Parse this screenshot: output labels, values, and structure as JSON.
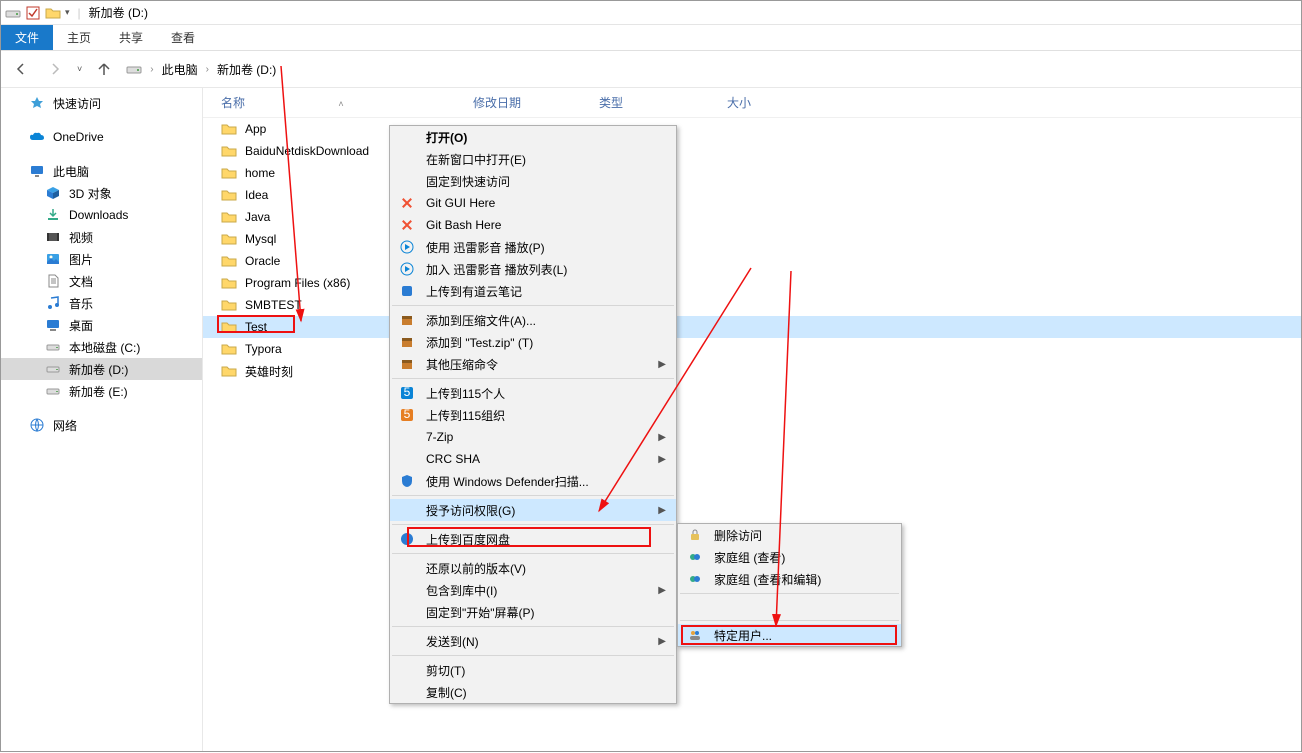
{
  "titlebar": {
    "title": "新加卷 (D:)"
  },
  "ribbon": {
    "file": "文件",
    "home": "主页",
    "share": "共享",
    "view": "查看"
  },
  "breadcrumb": {
    "root": "此电脑",
    "current": "新加卷 (D:)"
  },
  "sidebar": {
    "quick_access": "快速访问",
    "onedrive": "OneDrive",
    "this_pc": "此电脑",
    "objects3d": "3D 对象",
    "downloads": "Downloads",
    "videos": "视频",
    "pictures": "图片",
    "documents": "文档",
    "music": "音乐",
    "desktop": "桌面",
    "local_c": "本地磁盘 (C:)",
    "vol_d": "新加卷 (D:)",
    "vol_e": "新加卷 (E:)",
    "network": "网络"
  },
  "columns": {
    "name": "名称",
    "date": "修改日期",
    "type": "类型",
    "size": "大小"
  },
  "files": [
    {
      "name": "App"
    },
    {
      "name": "BaiduNetdiskDownload"
    },
    {
      "name": "home"
    },
    {
      "name": "Idea"
    },
    {
      "name": "Java"
    },
    {
      "name": "Mysql"
    },
    {
      "name": "Oracle"
    },
    {
      "name": "Program Files (x86)"
    },
    {
      "name": "SMBTEST"
    },
    {
      "name": "Test"
    },
    {
      "name": "Typora"
    },
    {
      "name": "英雄时刻"
    }
  ],
  "context_menu": {
    "open": "打开(O)",
    "open_new_window": "在新窗口中打开(E)",
    "pin_quick": "固定到快速访问",
    "git_gui": "Git GUI Here",
    "git_bash": "Git Bash Here",
    "xunlei_play": "使用 迅雷影音 播放(P)",
    "xunlei_list": "加入 迅雷影音 播放列表(L)",
    "youdao": "上传到有道云笔记",
    "add_archive": "添加到压缩文件(A)...",
    "add_test_zip": "添加到 \"Test.zip\" (T)",
    "other_compress": "其他压缩命令",
    "upload_115p": "上传到115个人",
    "upload_115g": "上传到115组织",
    "seven_zip": "7-Zip",
    "crc_sha": "CRC SHA",
    "defender": "使用 Windows Defender扫描...",
    "grant_access": "授予访问权限(G)",
    "baidu_pan": "上传到百度网盘",
    "restore_prev": "还原以前的版本(V)",
    "include_lib": "包含到库中(I)",
    "pin_start": "固定到\"开始\"屏幕(P)",
    "send_to": "发送到(N)",
    "cut": "剪切(T)",
    "copy": "复制(C)"
  },
  "submenu": {
    "remove_access": "删除访问",
    "homegroup_view": "家庭组 (查看)",
    "homegroup_edit": "家庭组 (查看和编辑)",
    "specific_user": "特定用户..."
  }
}
